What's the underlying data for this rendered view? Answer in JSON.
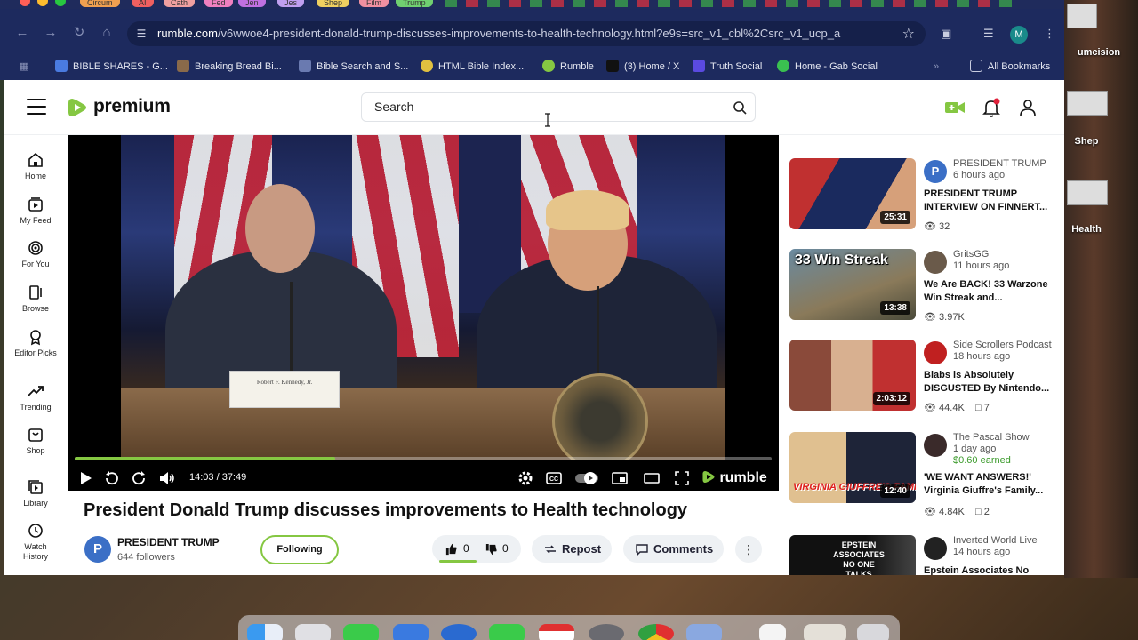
{
  "browser": {
    "url_host": "rumble.com",
    "url_path": "/v6wwoe4-president-donald-trump-discusses-improvements-to-health-technology.html?e9s=src_v1_cbl%2Csrc_v1_ucp_a",
    "profile_initial": "M",
    "tabs": [
      "Circum",
      "AI",
      "Cath",
      "Fed",
      "Jen",
      "Jes",
      "Shep",
      "Film",
      "Trump"
    ],
    "bookmarks": [
      {
        "label": "BIBLE SHARES - G...",
        "color": "#4a7be0"
      },
      {
        "label": "Breaking Bread Bi...",
        "color": "#8a6a4a"
      },
      {
        "label": "Bible Search and S...",
        "color": "#6a7ab0"
      },
      {
        "label": "HTML Bible Index...",
        "color": "#e0c040"
      },
      {
        "label": "Rumble",
        "color": "#85c742"
      },
      {
        "label": "(3) Home / X",
        "color": "#111111"
      },
      {
        "label": "Truth Social",
        "color": "#5a4ae0"
      },
      {
        "label": "Home - Gab Social",
        "color": "#3ac050"
      }
    ],
    "all_bookmarks": "All Bookmarks"
  },
  "desktop": {
    "labels": [
      "umcision",
      "Shep",
      "Health"
    ]
  },
  "header": {
    "logo_text": "premium",
    "search_placeholder": "Search"
  },
  "sidebar": {
    "items": [
      {
        "label": "Home"
      },
      {
        "label": "My Feed"
      },
      {
        "label": "For You"
      },
      {
        "label": "Browse"
      },
      {
        "label": "Editor Picks"
      },
      {
        "label": "Trending"
      },
      {
        "label": "Shop"
      },
      {
        "label": "Library"
      },
      {
        "label": "Watch History"
      }
    ]
  },
  "player": {
    "time": "14:03 / 37:49",
    "progress": 0.374,
    "nameplate": "Robert F. Kennedy, Jr.",
    "watermark": "rumble"
  },
  "video": {
    "title": "President Donald Trump discusses improvements to Health technology",
    "channel_initial": "P",
    "channel_name": "PRESIDENT TRUMP",
    "followers": "644 followers",
    "follow_label": "Following",
    "likes": "0",
    "dislikes": "0",
    "repost_label": "Repost",
    "comments_label": "Comments"
  },
  "recommendations": [
    {
      "channel": "PRESIDENT TRUMP",
      "time": "6 hours ago",
      "earned": "",
      "title": "PRESIDENT TRUMP INTERVIEW ON FINNERT...",
      "views": "32",
      "comments": "",
      "duration": "25:31",
      "avatar_color": "#3b6fc6",
      "thumb_a": "#1a2a5e",
      "thumb_b": "#c03030"
    },
    {
      "channel": "GritsGG",
      "time": "11 hours ago",
      "earned": "",
      "title": "We Are BACK! 33 Warzone Win Streak and...",
      "views": "3.97K",
      "comments": "",
      "duration": "13:38",
      "avatar_color": "#6a5a4a",
      "thumb_a": "#4a6a8a",
      "thumb_b": "#8a7a5a",
      "overlay": "33 Win Streak"
    },
    {
      "channel": "Side Scrollers Podcast",
      "time": "18 hours ago",
      "earned": "",
      "title": "Blabs is Absolutely DISGUSTED By Nintendo...",
      "views": "44.4K",
      "comments": "7",
      "duration": "2:03:12",
      "avatar_color": "#c02020",
      "thumb_a": "#c03030",
      "thumb_b": "#2a2a2a"
    },
    {
      "channel": "The Pascal Show",
      "time": "1 day ago",
      "earned": "$0.60 earned",
      "title": "'WE WANT ANSWERS!' Virginia Giuffre's Family...",
      "views": "4.84K",
      "comments": "2",
      "duration": "12:40",
      "avatar_color": "#3a2a2a",
      "thumb_a": "#b04040",
      "thumb_b": "#e0c090",
      "overlay": "VIRGINIA GIUFFRE'S FAMILY"
    },
    {
      "channel": "Inverted World Live",
      "time": "14 hours ago",
      "earned": "",
      "title": "Epstein Associates No",
      "views": "",
      "comments": "",
      "duration": "",
      "avatar_color": "#222222",
      "thumb_a": "#111111",
      "thumb_b": "#444444",
      "overlay": "EPSTEIN ASSOCIATES NO ONE TALKS ABOUT"
    }
  ]
}
